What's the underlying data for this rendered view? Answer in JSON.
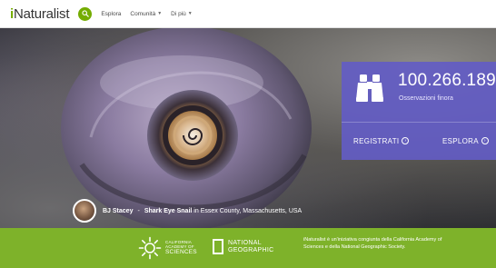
{
  "header": {
    "logo_prefix": "i",
    "logo_rest": "Naturalist",
    "nav": [
      {
        "label": "Esplora",
        "has_caret": false
      },
      {
        "label": "Comunità",
        "has_caret": true
      },
      {
        "label": "Di più",
        "has_caret": true
      }
    ]
  },
  "hero": {
    "credit": {
      "photographer": "BJ Stacey",
      "separator": "-",
      "species": "Shark Eye Snail",
      "location": "in Essex County, Massachusetts, USA"
    }
  },
  "stats": {
    "count": "100.266.189",
    "label": "Osservazioni finora",
    "register_label": "REGISTRATI",
    "explore_label": "ESPLORA"
  },
  "partners": {
    "cas_line1": "CALIFORNIA",
    "cas_line2": "ACADEMY OF",
    "cas_line3": "SCIENCES",
    "natgeo_line1": "NATIONAL",
    "natgeo_line2": "GEOGRAPHIC",
    "description": "iNaturalist è un'iniziativa congiunta della California Academy of Sciences e della National Geographic Society."
  },
  "colors": {
    "brand_green": "#74ac00",
    "band_green": "#7eb22a",
    "stats_purple": "#635cc4"
  }
}
